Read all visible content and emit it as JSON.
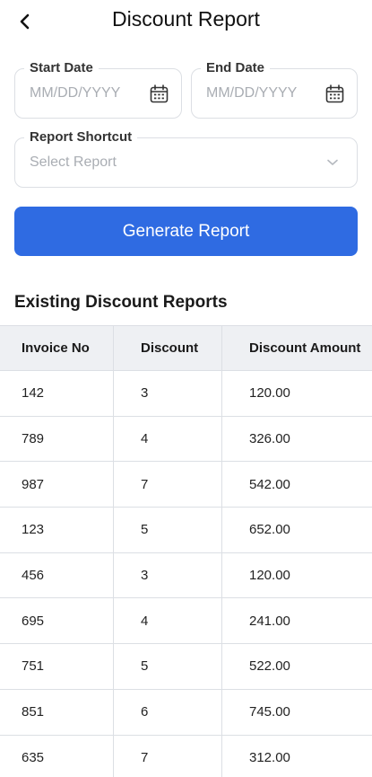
{
  "header": {
    "title": "Discount Report",
    "back_icon": "chevron-left-icon"
  },
  "form": {
    "start_date": {
      "label": "Start Date",
      "placeholder": "MM/DD/YYYY",
      "icon": "calendar-icon"
    },
    "end_date": {
      "label": "End Date",
      "placeholder": "MM/DD/YYYY",
      "icon": "calendar-icon"
    },
    "shortcut": {
      "label": "Report Shortcut",
      "placeholder": "Select Report",
      "icon": "chevron-down-icon"
    },
    "generate_label": "Generate Report",
    "accent": "#2f6be2"
  },
  "reports": {
    "title": "Existing Discount Reports",
    "columns": [
      "Invoice No",
      "Discount",
      "Discount Amount"
    ],
    "rows": [
      [
        "142",
        "3",
        "120.00"
      ],
      [
        "789",
        "4",
        "326.00"
      ],
      [
        "987",
        "7",
        "542.00"
      ],
      [
        "123",
        "5",
        "652.00"
      ],
      [
        "456",
        "3",
        "120.00"
      ],
      [
        "695",
        "4",
        "241.00"
      ],
      [
        "751",
        "5",
        "522.00"
      ],
      [
        "851",
        "6",
        "745.00"
      ],
      [
        "635",
        "7",
        "312.00"
      ]
    ]
  }
}
